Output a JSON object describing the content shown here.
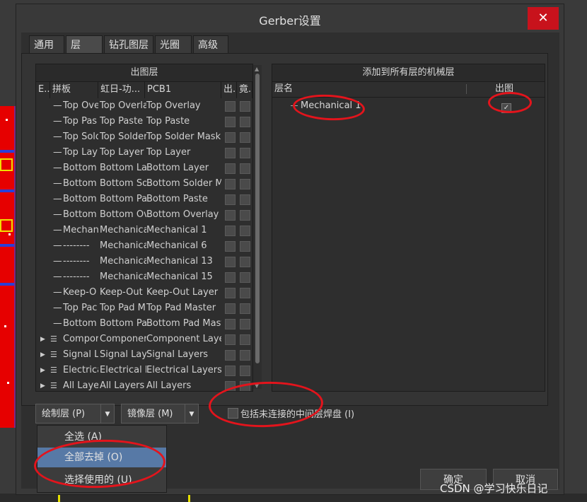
{
  "dialog": {
    "title": "Gerber设置",
    "close_glyph": "✕"
  },
  "tabs": [
    {
      "label": "通用"
    },
    {
      "label": "层"
    },
    {
      "label": "钻孔图层"
    },
    {
      "label": "光圈"
    },
    {
      "label": "高级"
    }
  ],
  "left_panel": {
    "header": "出图层",
    "columns": [
      "E...",
      "拼板",
      "虹日-功...",
      "PCB1",
      "出...",
      "竟..."
    ],
    "rows": [
      {
        "c1": "Top Ove",
        "c2": "Top Overla",
        "c3": "Top Overlay"
      },
      {
        "c1": "Top Pas",
        "c2": "Top Paste",
        "c3": "Top Paste"
      },
      {
        "c1": "Top Sold",
        "c2": "Top Solder",
        "c3": "Top Solder Mask"
      },
      {
        "c1": "Top Lay",
        "c2": "Top Layer",
        "c3": "Top Layer"
      },
      {
        "c1": "Bottom",
        "c2": "Bottom La",
        "c3": "Bottom Layer"
      },
      {
        "c1": "Bottom",
        "c2": "Bottom So",
        "c3": "Bottom Solder M"
      },
      {
        "c1": "Bottom",
        "c2": "Bottom Pa",
        "c3": "Bottom Paste"
      },
      {
        "c1": "Bottom",
        "c2": "Bottom Ov",
        "c3": "Bottom Overlay"
      },
      {
        "c1": "Mechan",
        "c2": "Mechanica",
        "c3": "Mechanical 1"
      },
      {
        "c1": "--------",
        "c2": "Mechanica",
        "c3": "Mechanical 6"
      },
      {
        "c1": "--------",
        "c2": "Mechanica",
        "c3": "Mechanical 13"
      },
      {
        "c1": "--------",
        "c2": "Mechanica",
        "c3": "Mechanical 15"
      },
      {
        "c1": "Keep-O",
        "c2": "Keep-Out",
        "c3": "Keep-Out Layer"
      },
      {
        "c1": "Top Pac",
        "c2": "Top Pad M",
        "c3": "Top Pad Master"
      },
      {
        "c1": "Bottom",
        "c2": "Bottom Pa",
        "c3": "Bottom Pad Mast"
      },
      {
        "c1": "Compor",
        "c2": "Componer",
        "c3": "Component Laye"
      },
      {
        "c1": "Signal L",
        "c2": "Signal Laye",
        "c3": "Signal Layers"
      },
      {
        "c1": "Electrica",
        "c2": "Electrical L",
        "c3": "Electrical Layers"
      },
      {
        "c1": "All Laye",
        "c2": "All Layers",
        "c3": "All Layers"
      }
    ]
  },
  "right_panel": {
    "header": "添加到所有层的机械层",
    "col_name": "层名",
    "col_plot": "出图",
    "row_label": "Mechanical 1",
    "row_checked": "✓"
  },
  "controls": {
    "plot_layers_btn": "绘制层 (P)",
    "mirror_layers_btn": "镜像层 (M)",
    "include_label": "包括未连接的中间层焊盘 (I)"
  },
  "menu": {
    "items": [
      "全选 (A)",
      "全部去掉 (O)",
      "选择使用的 (U)"
    ]
  },
  "buttons": {
    "ok": "确定",
    "cancel": "取消"
  },
  "watermark": "CSDN @学习快乐日记",
  "colors": {
    "annotation": "#e3141c",
    "highlight": "#5779a6",
    "close": "#c8121c"
  }
}
